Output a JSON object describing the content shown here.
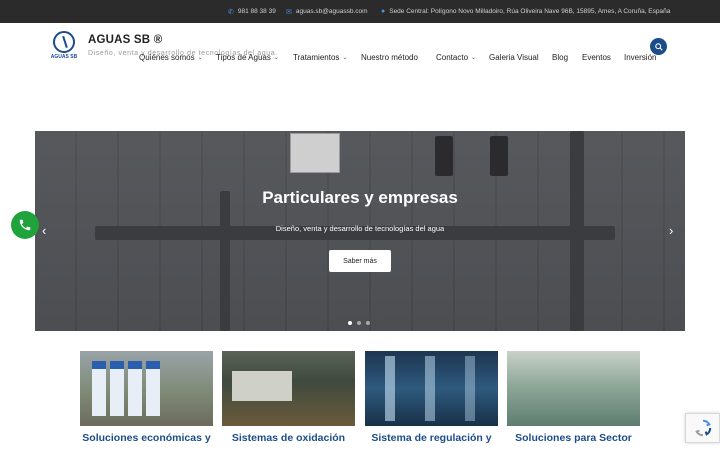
{
  "topbar": {
    "phone": "981 88 38 39",
    "email": "aguas.sb@aguassb.com",
    "address": "Sede Central: Polígono Novo Milladoiro, Rúa Oliveira Nave 96B, 15895, Ames, A Coruña, España"
  },
  "header": {
    "logo_text": "AGUAS SB",
    "brand": "AGUAS SB ®",
    "tagline": "Diseño, venta y desarrollo de tecnologías del agua."
  },
  "nav": {
    "items": [
      {
        "label": "Quiénes somos",
        "dropdown": true
      },
      {
        "label": "Tipos de Aguas",
        "dropdown": true
      },
      {
        "label": "Tratamientos",
        "dropdown": true
      },
      {
        "label": "Nuestro método",
        "dropdown": false
      },
      {
        "label": "Contacto",
        "dropdown": true
      },
      {
        "label": "Galeria Visual",
        "dropdown": false
      },
      {
        "label": "Blog",
        "dropdown": false
      },
      {
        "label": "Eventos",
        "dropdown": false
      },
      {
        "label": "Inversión",
        "dropdown": false
      }
    ]
  },
  "hero": {
    "title": "Particulares y empresas",
    "subtitle": "Diseño, venta y desarrollo de tecnologías del agua",
    "button_label": "Saber más",
    "active_slide": 1,
    "slide_count": 3
  },
  "cards": [
    {
      "title": "Soluciones económicas y"
    },
    {
      "title": "Sistemas de oxidación"
    },
    {
      "title": "Sistema de regulación y"
    },
    {
      "title": "Soluciones para Sector"
    }
  ],
  "colors": {
    "brand_blue": "#1b4d8a",
    "topbar_bg": "#2b2b2b",
    "call_green": "#1fa33a"
  },
  "icons": {
    "phone": "phone-icon",
    "email": "envelope-icon",
    "address": "globe-icon",
    "search": "search-icon",
    "call": "phone-call-icon"
  }
}
